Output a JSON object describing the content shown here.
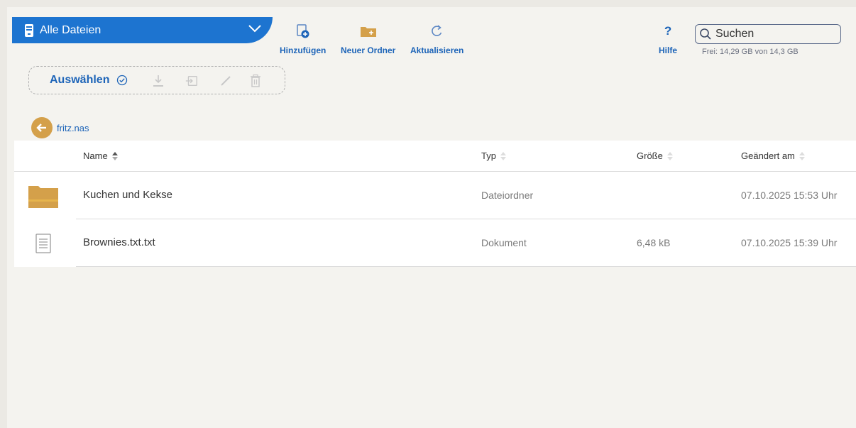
{
  "header": {
    "dropdown_label": "Alle Dateien",
    "toolbar": {
      "add": "Hinzufügen",
      "new_folder": "Neuer Ordner",
      "refresh": "Aktualisieren",
      "help": "Hilfe"
    },
    "search": {
      "placeholder": "Suchen"
    },
    "storage_info": "Frei: 14,29 GB von 14,3 GB"
  },
  "selection": {
    "label": "Auswählen"
  },
  "breadcrumb": {
    "path": "fritz.nas"
  },
  "table": {
    "columns": [
      "Name",
      "Typ",
      "Größe",
      "Geändert am"
    ],
    "rows": [
      {
        "icon": "folder-icon",
        "name": "Kuchen und Kekse",
        "type": "Dateiordner",
        "size": "",
        "modified": "07.10.2025 15:53 Uhr"
      },
      {
        "icon": "document-icon",
        "name": "Brownies.txt.txt",
        "type": "Dokument",
        "size": "6,48 kB",
        "modified": "07.10.2025 15:39 Uhr"
      }
    ]
  },
  "colors": {
    "accent": "#1d74d0",
    "link": "#1d64b8",
    "folder": "#d4a04a",
    "disabled": "#c8c8c8"
  }
}
